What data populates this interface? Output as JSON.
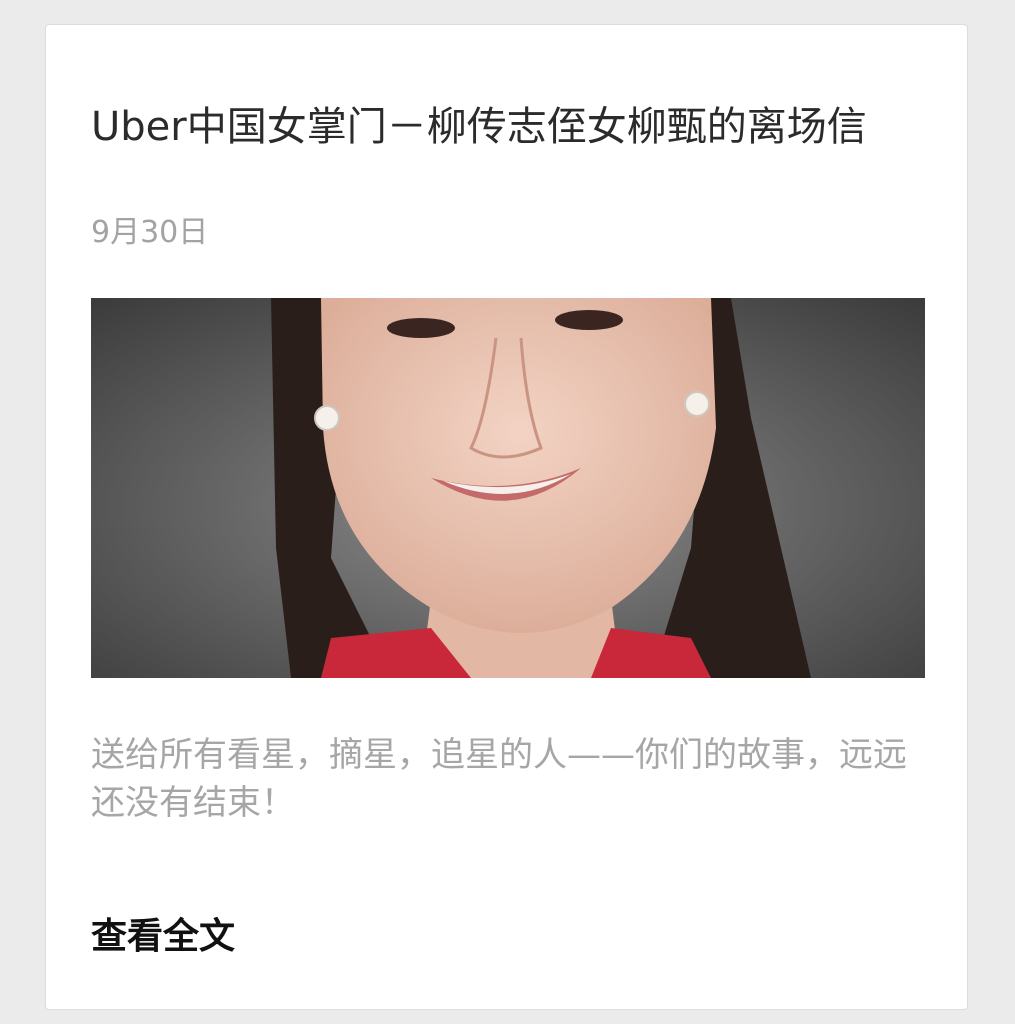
{
  "article": {
    "title": "Uber中国女掌门－柳传志侄女柳甄的离场信",
    "date": "9月30日",
    "cover_image": {
      "subject": "portrait-photo",
      "background_color": "#5a5a5a",
      "top_color": "#c8283a"
    },
    "digest": "送给所有看星，摘星，追星的人——你们的故事，远远还没有结束！",
    "read_more_label": "查看全文"
  }
}
